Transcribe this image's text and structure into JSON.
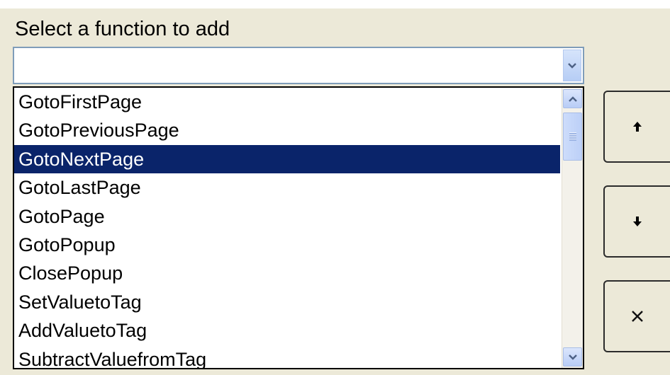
{
  "dialog": {
    "title": "Select a function to add"
  },
  "combo": {
    "value": ""
  },
  "functions": {
    "items": [
      "GotoFirstPage",
      "GotoPreviousPage",
      "GotoNextPage",
      "GotoLastPage",
      "GotoPage",
      "GotoPopup",
      "ClosePopup",
      "SetValuetoTag",
      "AddValuetoTag",
      "SubtractValuefromTag"
    ],
    "selected": "GotoNextPage"
  },
  "buttons": {
    "move_up_icon": "arrow-up-icon",
    "move_down_icon": "arrow-down-icon",
    "remove_icon": "close-icon"
  },
  "colors": {
    "background": "#ece9d8",
    "selection": "#0a246a",
    "combo_border": "#7f9db9"
  }
}
